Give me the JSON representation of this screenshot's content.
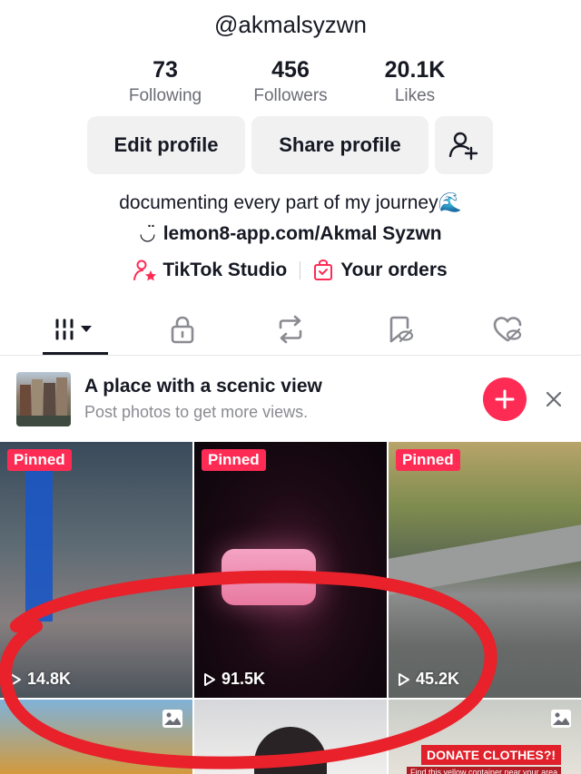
{
  "profile": {
    "username": "@akmalsyzwn",
    "stats": [
      {
        "value": "73",
        "label": "Following"
      },
      {
        "value": "456",
        "label": "Followers"
      },
      {
        "value": "20.1K",
        "label": "Likes"
      }
    ],
    "buttons": {
      "edit": "Edit profile",
      "share": "Share profile"
    },
    "bio": "documenting every part of my journey🌊",
    "link": "lemon8-app.com/Akmal Syzwn",
    "studio": "TikTok Studio",
    "orders": "Your orders"
  },
  "suggestion": {
    "title": "A place with a scenic view",
    "subtitle": "Post photos to get more views."
  },
  "videos": [
    {
      "pinned": "Pinned",
      "views": "14.8K"
    },
    {
      "pinned": "Pinned",
      "views": "91.5K"
    },
    {
      "pinned": "Pinned",
      "views": "45.2K"
    }
  ],
  "donate_banner": {
    "title": "DONATE CLOTHES?!",
    "sub": "Find this yellow container near your area"
  },
  "colors": {
    "accent": "#fe2c55",
    "text": "#161823",
    "muted": "#6b6d75",
    "annotation": "#e8212a"
  }
}
